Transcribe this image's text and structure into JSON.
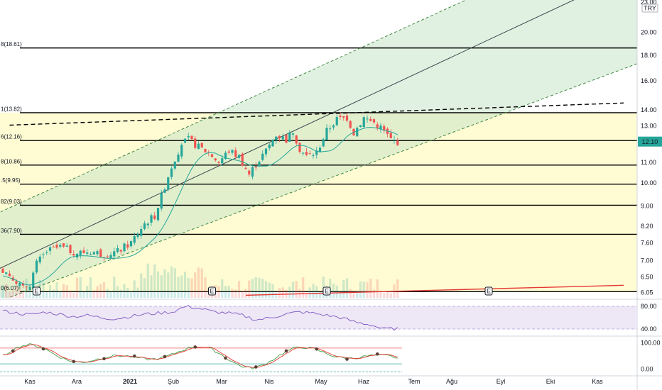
{
  "app": {
    "currency": "TRY",
    "last_price_label": "12.10"
  },
  "colors": {
    "up": "#26a69a",
    "down": "#ef5350",
    "channel_fill": "#c8e6c9",
    "fib_fill": "#fff9c4",
    "ma_line": "#26a69a",
    "price_badge": "#26a69a",
    "rsi_line": "#7e57c2",
    "rsi_band": "#ede7f6",
    "trendline": "#e53935"
  },
  "chart_data": [
    {
      "type": "candlestick",
      "panel": "price",
      "scale": "log",
      "y_axis_ticks": [
        6.05,
        6.5,
        7.0,
        7.6,
        8.2,
        9.0,
        10.0,
        11.0,
        12.0,
        13.0,
        14.0,
        16.0,
        18.0,
        20.0,
        23.0
      ],
      "y_axis_tick_labels": [
        "6.05",
        "6.50",
        "7.00",
        "7.60",
        "8.20",
        "9.00",
        "10.00",
        "11.00",
        "12.00",
        "13.00",
        "14.00",
        "16.00",
        "18.00",
        "20.00",
        "23.00"
      ],
      "x_axis_labels": [
        "Kas",
        "Ara",
        "2021",
        "Şub",
        "Mar",
        "Nis",
        "May",
        "Haz",
        "Tem",
        "Ağu",
        "Eyl",
        "Eki",
        "Kas"
      ],
      "fib_levels": [
        {
          "label": "0(6.07)",
          "value": 6.07
        },
        {
          "label": "36(7.90)",
          "value": 7.9
        },
        {
          "label": "82(9.03)",
          "value": 9.03
        },
        {
          "label": ".5(9.95)",
          "value": 9.95
        },
        {
          "label": "8(10.86)",
          "value": 10.86
        },
        {
          "label": "6(12.16)",
          "value": 12.16
        },
        {
          "label": "1(13.82)",
          "value": 13.82
        },
        {
          "label": "8(18.61)",
          "value": 18.61
        }
      ],
      "last_price": 12.1,
      "channel": {
        "lower_start": {
          "x_index": 6,
          "value": 6.05
        },
        "lower_end": {
          "x_index": 150,
          "value": 13.9
        },
        "mid_start": {
          "x_index": 0,
          "value": 6.8
        },
        "mid_end": {
          "x_index": 168,
          "value": 23.0
        },
        "upper_start": {
          "x_index": 0,
          "value": 8.8
        },
        "upper_end": {
          "x_index": 136,
          "value": 23.0
        }
      },
      "resistance_line": {
        "start": {
          "x_index": 2,
          "value": 13.05
        },
        "end": {
          "x_index": 184,
          "value": 14.45
        }
      },
      "support_trendline": {
        "start": {
          "x_index": 72,
          "value": 5.97
        },
        "end": {
          "x_index": 184,
          "value": 6.25
        }
      },
      "event_markers": [
        {
          "label": "E",
          "x_index": 10
        },
        {
          "label": "E",
          "x_index": 62
        },
        {
          "label": "E",
          "x_index": 96
        },
        {
          "label": "E",
          "x_index": 144
        }
      ],
      "anchor_points": [
        {
          "i": 0,
          "close": 6.7
        },
        {
          "i": 3,
          "close": 6.5
        },
        {
          "i": 6,
          "close": 6.15
        },
        {
          "i": 8,
          "close": 6.3
        },
        {
          "i": 10,
          "close": 6.9
        },
        {
          "i": 13,
          "close": 7.3
        },
        {
          "i": 17,
          "close": 7.45
        },
        {
          "i": 22,
          "close": 7.25
        },
        {
          "i": 26,
          "close": 7.3
        },
        {
          "i": 30,
          "close": 7.2
        },
        {
          "i": 34,
          "close": 7.3
        },
        {
          "i": 38,
          "close": 7.6
        },
        {
          "i": 42,
          "close": 8.3
        },
        {
          "i": 45,
          "close": 8.6
        },
        {
          "i": 47,
          "close": 9.4
        },
        {
          "i": 50,
          "close": 10.8
        },
        {
          "i": 53,
          "close": 12.0
        },
        {
          "i": 55,
          "close": 12.2
        },
        {
          "i": 58,
          "close": 11.8
        },
        {
          "i": 61,
          "close": 11.5
        },
        {
          "i": 64,
          "close": 11.0
        },
        {
          "i": 67,
          "close": 11.6
        },
        {
          "i": 70,
          "close": 11.3
        },
        {
          "i": 73,
          "close": 10.4
        },
        {
          "i": 75,
          "close": 10.9
        },
        {
          "i": 78,
          "close": 11.6
        },
        {
          "i": 81,
          "close": 12.5
        },
        {
          "i": 84,
          "close": 12.2
        },
        {
          "i": 86,
          "close": 12.7
        },
        {
          "i": 88,
          "close": 11.7
        },
        {
          "i": 90,
          "close": 11.3
        },
        {
          "i": 93,
          "close": 11.5
        },
        {
          "i": 96,
          "close": 12.7
        },
        {
          "i": 99,
          "close": 13.4
        },
        {
          "i": 102,
          "close": 13.5
        },
        {
          "i": 104,
          "close": 12.6
        },
        {
          "i": 107,
          "close": 13.5
        },
        {
          "i": 110,
          "close": 13.2
        },
        {
          "i": 112,
          "close": 12.9
        },
        {
          "i": 115,
          "close": 12.2
        },
        {
          "i": 117,
          "close": 12.1
        }
      ]
    },
    {
      "type": "line",
      "panel": "rsi",
      "y_axis_tick_labels": [
        "80.00",
        "40.00"
      ],
      "band": [
        40,
        80
      ],
      "values_sample": [
        72,
        68,
        65,
        70,
        66,
        62,
        64,
        60,
        58,
        62,
        66,
        68,
        70,
        80,
        76,
        70,
        68,
        64,
        56,
        60,
        66,
        70,
        68,
        64,
        60,
        52,
        48,
        40,
        41
      ]
    },
    {
      "type": "line",
      "panel": "stochastic",
      "y_axis_tick_labels": [
        "100.00",
        "0.00"
      ]
    }
  ]
}
